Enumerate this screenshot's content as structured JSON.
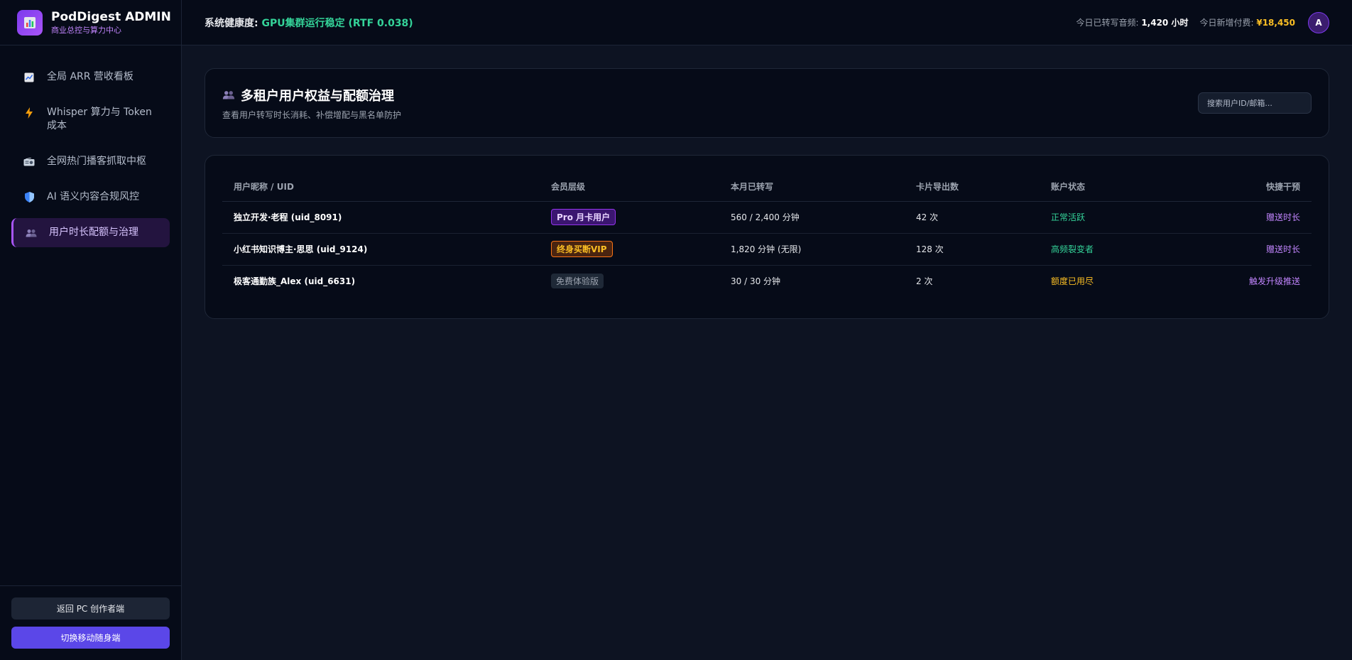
{
  "brand": {
    "title": "PodDigest ADMIN",
    "subtitle": "商业总控与算力中心",
    "icon": "bar-chart-icon"
  },
  "nav": [
    {
      "label": "全局 ARR 营收看板",
      "icon": "trend-chart-icon",
      "active": false
    },
    {
      "label": "Whisper 算力与 Token 成本",
      "icon": "lightning-icon",
      "active": false
    },
    {
      "label": "全网热门播客抓取中枢",
      "icon": "radio-icon",
      "active": false
    },
    {
      "label": "AI 语义内容合规风控",
      "icon": "shield-icon",
      "active": false
    },
    {
      "label": "用户时长配额与治理",
      "icon": "users-icon",
      "active": true
    }
  ],
  "sidebar_bottom": {
    "back_label": "返回 PC 创作者端",
    "mobile_label": "切换移动随身端"
  },
  "topbar": {
    "health_label": "系统健康度:",
    "health_value": "GPU集群运行稳定 (RTF 0.038)",
    "audio_label": "今日已转写音频:",
    "audio_value": "1,420 小时",
    "pay_label": "今日新增付费:",
    "pay_value": "¥18,450",
    "avatar": "A"
  },
  "page": {
    "title": "多租户用户权益与配额治理",
    "subtitle": "查看用户转写时长消耗、补偿增配与黑名单防护",
    "search_placeholder": "搜索用户ID/邮箱..."
  },
  "table": {
    "headers": [
      "用户昵称 / UID",
      "会员层级",
      "本月已转写",
      "卡片导出数",
      "账户状态",
      "快捷干预"
    ],
    "rows": [
      {
        "name": "独立开发·老程 (uid_8091)",
        "tier": "Pro 月卡用户",
        "tier_type": "pro",
        "used": "560 / 2,400 分钟",
        "exports": "42 次",
        "status": "正常活跃",
        "status_type": "green",
        "action": "赠送时长"
      },
      {
        "name": "小红书知识博主·思思 (uid_9124)",
        "tier": "终身买断VIP",
        "tier_type": "vip",
        "used": "1,820 分钟 (无限)",
        "exports": "128 次",
        "status": "高频裂变者",
        "status_type": "green",
        "action": "赠送时长"
      },
      {
        "name": "极客通勤族_Alex (uid_6631)",
        "tier": "免费体验版",
        "tier_type": "free",
        "used": "30 / 30 分钟",
        "exports": "2 次",
        "status": "额度已用尽",
        "status_type": "orange",
        "action": "触发升级推送"
      }
    ]
  },
  "colors": {
    "accent": "#a855f7",
    "success": "#34d399",
    "warning": "#fbbf24",
    "primary_button": "#5b47e8"
  }
}
